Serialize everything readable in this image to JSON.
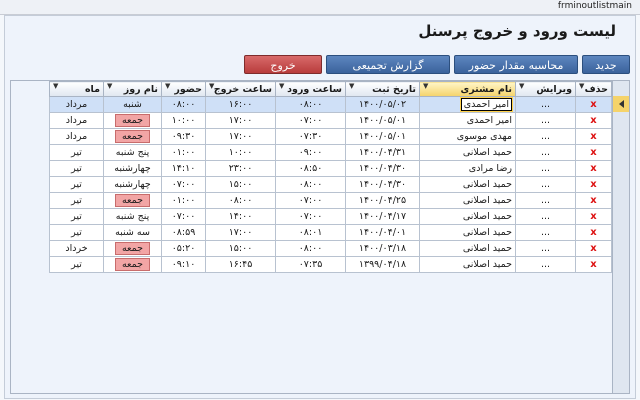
{
  "window": {
    "title": "frminoutlistmain"
  },
  "form": {
    "title": "لیست ورود و خروج پرسنل"
  },
  "toolbar": {
    "new_label": "جدید",
    "attendance_label": "محاسبه مقدار حضور",
    "summary_label": "گزارش تجمیعی",
    "exit_label": "خروج"
  },
  "columns": {
    "delete": "حذف",
    "edit": "ویرایش",
    "customer": "نام مشتری",
    "date": "تاریخ ثبت",
    "entry": "ساعت ورود",
    "exit": "ساعت خروج",
    "presence": "حضور",
    "day": "نام روز",
    "month": "ماه"
  },
  "rows": [
    {
      "del": "x",
      "edit": "...",
      "name": "امیر احمدی",
      "date": "۱۴۰۰/۰۵/۰۲",
      "entry": "۰۸:۰۰",
      "exit": "۱۶:۰۰",
      "presence": "۰۸:۰۰",
      "day": "شنبه",
      "month": "مرداد"
    },
    {
      "del": "x",
      "edit": "...",
      "name": "امیر احمدی",
      "date": "۱۴۰۰/۰۵/۰۱",
      "entry": "۰۷:۰۰",
      "exit": "۱۷:۰۰",
      "presence": "۱۰:۰۰",
      "day": "جمعه",
      "month": "مرداد"
    },
    {
      "del": "x",
      "edit": "...",
      "name": "مهدی موسوی",
      "date": "۱۴۰۰/۰۵/۰۱",
      "entry": "۰۷:۳۰",
      "exit": "۱۷:۰۰",
      "presence": "۰۹:۳۰",
      "day": "جمعه",
      "month": "مرداد"
    },
    {
      "del": "x",
      "edit": "...",
      "name": "حمید اصلانی",
      "date": "۱۴۰۰/۰۴/۳۱",
      "entry": "۰۹:۰۰",
      "exit": "۱۰:۰۰",
      "presence": "۰۱:۰۰",
      "day": "پنج شنبه",
      "month": "تیر"
    },
    {
      "del": "x",
      "edit": "...",
      "name": "رضا مرادی",
      "date": "۱۴۰۰/۰۴/۳۰",
      "entry": "۰۸:۵۰",
      "exit": "۲۳:۰۰",
      "presence": "۱۴:۱۰",
      "day": "چهارشنبه",
      "month": "تیر"
    },
    {
      "del": "x",
      "edit": "...",
      "name": "حمید اصلانی",
      "date": "۱۴۰۰/۰۴/۳۰",
      "entry": "۰۸:۰۰",
      "exit": "۱۵:۰۰",
      "presence": "۰۷:۰۰",
      "day": "چهارشنبه",
      "month": "تیر"
    },
    {
      "del": "x",
      "edit": "...",
      "name": "حمید اصلانی",
      "date": "۱۴۰۰/۰۴/۲۵",
      "entry": "۰۷:۰۰",
      "exit": "۰۸:۰۰",
      "presence": "۰۱:۰۰",
      "day": "جمعه",
      "month": "تیر"
    },
    {
      "del": "x",
      "edit": "...",
      "name": "حمید اصلانی",
      "date": "۱۴۰۰/۰۴/۱۷",
      "entry": "۰۷:۰۰",
      "exit": "۱۴:۰۰",
      "presence": "۰۷:۰۰",
      "day": "پنج شنبه",
      "month": "تیر"
    },
    {
      "del": "x",
      "edit": "...",
      "name": "حمید اصلانی",
      "date": "۱۴۰۰/۰۴/۰۱",
      "entry": "۰۸:۰۱",
      "exit": "۱۷:۰۰",
      "presence": "۰۸:۵۹",
      "day": "سه شنبه",
      "month": "تیر"
    },
    {
      "del": "x",
      "edit": "...",
      "name": "حمید اصلانی",
      "date": "۱۴۰۰/۰۳/۱۸",
      "entry": "۰۸:۰۰",
      "exit": "۱۵:۰۰",
      "presence": "۰۵:۲۰",
      "day": "جمعه",
      "month": "خرداد"
    },
    {
      "del": "x",
      "edit": "...",
      "name": "حمید اصلانی",
      "date": "۱۳۹۹/۰۴/۱۸",
      "entry": "۰۷:۳۵",
      "exit": "۱۶:۴۵",
      "presence": "۰۹:۱۰",
      "day": "جمعه",
      "month": "تیر"
    }
  ]
}
